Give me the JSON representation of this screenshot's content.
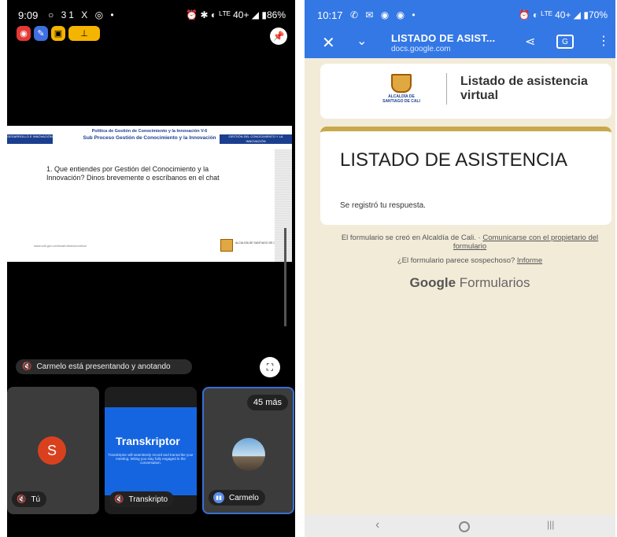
{
  "left_phone": {
    "status": {
      "time": "9:09",
      "icons": "○ 31 X ◎ •",
      "right": "⏰ ✱ ◐ ᴸᵀᴱ 40+ ◢ ▮86%"
    },
    "toolbar_pills": {
      "p1": "◉",
      "p2": "✎",
      "p3": "▣",
      "p4": "⊥"
    },
    "pin_icon": "📌",
    "slide": {
      "header1": "Política de Gestión de Conocimiento y la Innovación V-6",
      "header2": "Sub Proceso Gestión de Conocimiento y la Innovación",
      "tag_left": "DESARROLLO E INNOVACIÓN",
      "tag_right": "GESTIÓN DEL CONOCIMIENTO Y LA INNOVACIÓN",
      "question": "1. Que entiendes por Gestión del Conocimiento y la Innovación? Dinos brevemente  o  escríbanos en el chat",
      "url": "www.cali.gov.co/desarrolloeconomico/",
      "logo_caption": "ALCALDÍA DE SANTIAGO DE CALI"
    },
    "presenting_text": "Carmelo está presentando y anotando",
    "tiles": {
      "self": {
        "initial": "S",
        "label": "Tú"
      },
      "transkriptor": {
        "logo": "Transkriptor",
        "blurb": "Transkriptor will seamlessly record and transcribe your meeting, letting you stay fully engaged in the conversation.",
        "label": "Transkripto"
      },
      "carmelo": {
        "more": "45 más",
        "label": "Carmelo"
      }
    }
  },
  "right_phone": {
    "status": {
      "time": "10:17",
      "icons": "✆ ✉ ◉ ◉ •",
      "right": "⏰ ◐ ᴸᵀᴱ 40+ ◢ ▮70%"
    },
    "toolbar": {
      "title": "LISTADO DE ASIST...",
      "url": "docs.google.com",
      "translate": "G"
    },
    "header_card": {
      "crest_caption1": "ALCALDÍA DE",
      "crest_caption2": "SANTIAGO DE CALI",
      "title": "Listado de asistencia virtual"
    },
    "main_card": {
      "title": "LISTADO DE ASISTENCIA",
      "subtitle": "Se registró tu respuesta."
    },
    "footer": {
      "created_text": "El formulario se creó en Alcaldía de Cali. · ",
      "contact_link": "Comunicarse con el propietario del formulario",
      "suspicious_text": "¿El formulario parece sospechoso? ",
      "report_link": "Informe",
      "brand_google": "Google",
      "brand_forms": " Formularios"
    }
  }
}
